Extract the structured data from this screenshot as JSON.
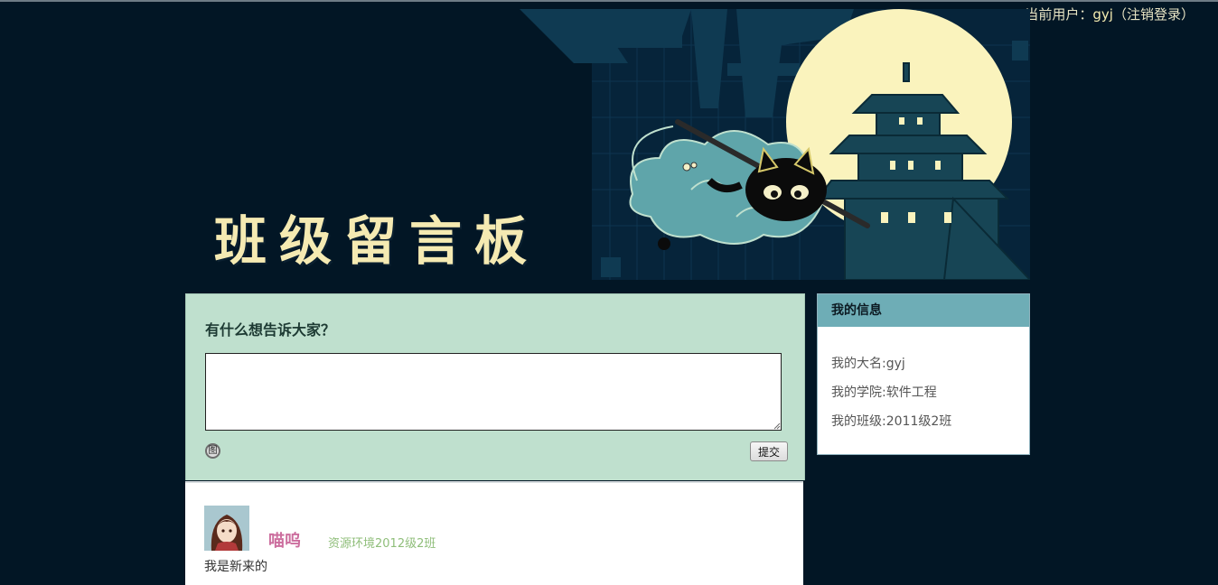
{
  "user_bar": {
    "prefix": "当前用户：",
    "username": "gyj",
    "logout": "（注销登录）"
  },
  "banner": {
    "title": "班级留言板"
  },
  "post": {
    "prompt": "有什么想告诉大家？",
    "textarea_value": "",
    "image_icon": "图",
    "submit_label": "提交"
  },
  "messages": [
    {
      "name": "喵呜",
      "class": "资源环境2012级2班",
      "text": "我是新来的"
    }
  ],
  "info": {
    "title": "我的信息",
    "rows": [
      "我的大名:gyj",
      "我的学院:软件工程",
      "我的班级:2011级2班"
    ]
  },
  "colors": {
    "background": "#021625",
    "post_panel": "#bfe0ce",
    "info_header": "#6eadb6",
    "name": "#cc6e9e",
    "class_text": "#8fbe7a"
  },
  "icons": [
    "image-icon",
    "moon-icon",
    "cat-ninja-illustration",
    "pagoda-illustration"
  ]
}
